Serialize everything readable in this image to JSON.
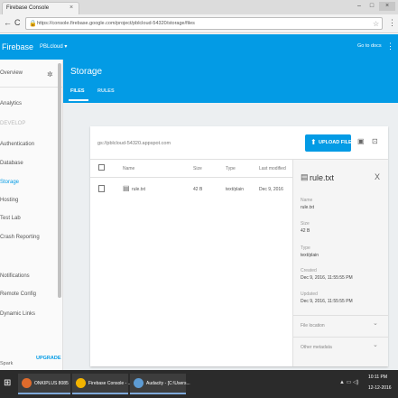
{
  "browser": {
    "tab_title": "Firebase Console",
    "tab_close": "×",
    "url": "https://console.firebase.google.com/project/pblcloud-54320/storage/files",
    "back": "←",
    "reload": "C",
    "lock": "🔒",
    "star": "☆",
    "menu": "⋮",
    "win_min": "–",
    "win_max": "□",
    "win_close": "×"
  },
  "firebase": {
    "title": "Firebase",
    "project": "PBLcloud ▾",
    "goto_docs": "Go to docs",
    "kebab": "⋮"
  },
  "sidebar": {
    "overview": "Overview",
    "gear": "✲",
    "items": [
      {
        "label": "Analytics",
        "state": "normal"
      },
      {
        "label": "DEVELOP",
        "state": "dim"
      },
      {
        "label": "Authentication",
        "state": "normal"
      },
      {
        "label": "Database",
        "state": "normal"
      },
      {
        "label": "Storage",
        "state": "active"
      },
      {
        "label": "Hosting",
        "state": "normal"
      },
      {
        "label": "Test Lab",
        "state": "normal"
      },
      {
        "label": "Crash Reporting",
        "state": "normal"
      },
      {
        "label": "Notifications",
        "state": "normal"
      },
      {
        "label": "Remote Config",
        "state": "normal"
      },
      {
        "label": "Dynamic Links",
        "state": "normal"
      }
    ],
    "plan": "Spark",
    "upgrade": "UPGRADE"
  },
  "storage": {
    "title": "Storage",
    "tabs": {
      "files": "FILES",
      "rules": "RULES"
    },
    "bucket": "gs://pblcloud-54320.appspot.com",
    "upload_icon": "⬆",
    "upload_label": "UPLOAD FILE",
    "newfolder_icon": "▣",
    "more_icon": "⊡",
    "columns": {
      "name": "Name",
      "size": "Size",
      "type": "Type",
      "modified": "Last modified"
    },
    "rows": [
      {
        "name": "rule.txt",
        "size": "42 B",
        "type": "text/plain",
        "modified": "Dec 9, 2016"
      }
    ],
    "file_icon": "▤"
  },
  "detail": {
    "file_icon": "▤",
    "title": "rule.txt",
    "close": "X",
    "name_label": "Name",
    "name_value": "rule.txt",
    "size_label": "Size",
    "size_value": "42 B",
    "type_label": "Type",
    "type_value": "text/plain",
    "created_label": "Created",
    "created_value": "Dec 9, 2016, 11:55:55 PM",
    "updated_label": "Updated",
    "updated_value": "Dec 9, 2016, 11:55:55 PM",
    "file_location": "File location",
    "other_metadata": "Other metadata",
    "chevron": "⌄"
  },
  "taskbar": {
    "start": "⊞",
    "apps": [
      {
        "label": "ONKIPLUS 8085",
        "color": "#e06b2c"
      },
      {
        "label": "Firebase Console - ...",
        "color": "#f2b300"
      },
      {
        "label": "Audacity - [C:\\Users...",
        "color": "#5d9bd3"
      }
    ],
    "tray": "▲ ▭ ◁)",
    "time": "10:11 PM",
    "date": "12-12-2016"
  }
}
